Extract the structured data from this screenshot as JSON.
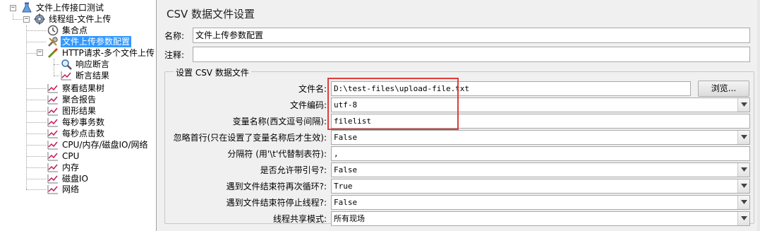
{
  "tree": {
    "items": [
      {
        "label": "文件上传接口测试",
        "icon": "test-plan-icon"
      },
      {
        "label": "线程组-文件上传",
        "icon": "gear-icon"
      },
      {
        "label": "集合点",
        "icon": "timer-icon"
      },
      {
        "label": "文件上传参数配置",
        "icon": "wrench-icon"
      },
      {
        "label": "HTTP请求-多个文件上传",
        "icon": "pipette-icon"
      },
      {
        "label": "响应断言",
        "icon": "magnifier-icon"
      },
      {
        "label": "断言结果",
        "icon": "chart-line-icon"
      },
      {
        "label": "察看结果树",
        "icon": "chart-line-icon"
      },
      {
        "label": "聚合报告",
        "icon": "chart-line-icon"
      },
      {
        "label": "图形结果",
        "icon": "chart-line-icon"
      },
      {
        "label": "每秒事务数",
        "icon": "chart-line-icon"
      },
      {
        "label": "每秒点击数",
        "icon": "chart-line-icon"
      },
      {
        "label": "CPU/内存/磁盘IO/网络",
        "icon": "chart-line-icon"
      },
      {
        "label": "CPU",
        "icon": "chart-line-icon"
      },
      {
        "label": "内存",
        "icon": "chart-line-icon"
      },
      {
        "label": "磁盘IO",
        "icon": "chart-line-icon"
      },
      {
        "label": "网络",
        "icon": "chart-line-icon"
      }
    ],
    "selected": "文件上传参数配置",
    "expander_collapsed": "−"
  },
  "panel": {
    "title": "CSV 数据文件设置",
    "name_label": "名称:",
    "name_value": "文件上传参数配置",
    "note_label": "注释:",
    "note_value": "",
    "group_title": "设置 CSV 数据文件",
    "fields": {
      "filename_label": "文件名:",
      "filename_value": "D:\\test-files\\upload-file.txt",
      "browse_label": "浏览...",
      "encoding_label": "文件编码:",
      "encoding_value": "utf-8",
      "varnames_label": "变量名称(西文逗号间隔):",
      "varnames_value": "filelist",
      "ignore_first_label": "忽略首行(只在设置了变量名称后才生效):",
      "ignore_first_value": "False",
      "delimiter_label": "分隔符 (用'\\t'代替制表符):",
      "delimiter_value": ",",
      "quoted_label": "是否允许带引号?:",
      "quoted_value": "False",
      "recycle_label": "遇到文件结束符再次循环?:",
      "recycle_value": "True",
      "stop_label": "遇到文件结束符停止线程?:",
      "stop_value": "False",
      "sharing_label": "线程共享模式:",
      "sharing_value": "所有现场"
    }
  },
  "colors": {
    "selection": "#3399ff",
    "highlight_box": "#e03c3c"
  }
}
